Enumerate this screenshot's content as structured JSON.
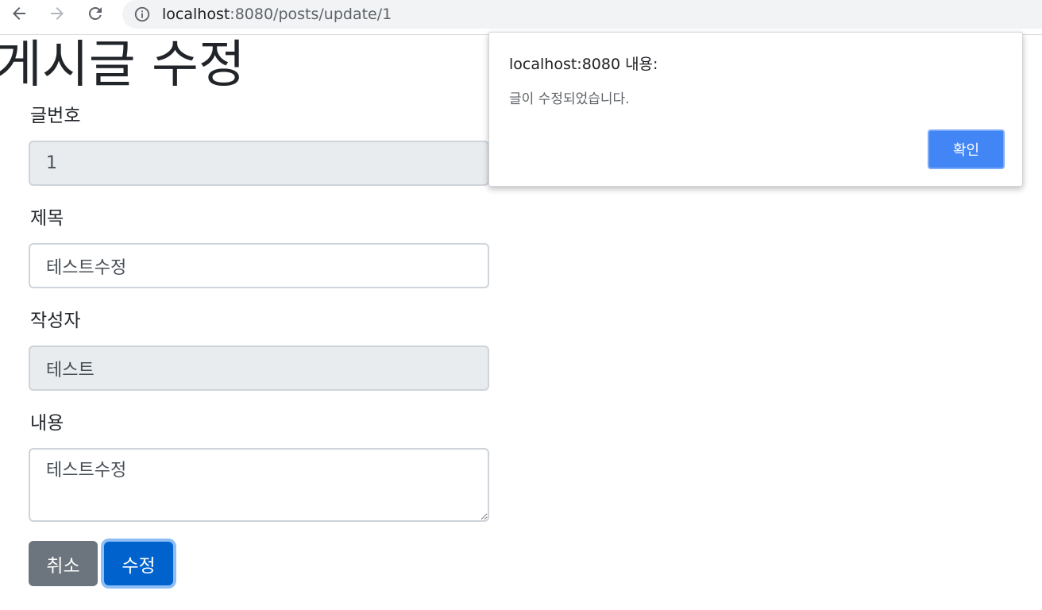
{
  "browser": {
    "url_host": "localhost",
    "url_path": ":8080/posts/update/1"
  },
  "page": {
    "title": "게시글 수정"
  },
  "form": {
    "post_number": {
      "label": "글번호",
      "value": "1"
    },
    "title_field": {
      "label": "제목",
      "value": "테스트수정"
    },
    "author": {
      "label": "작성자",
      "value": "테스트"
    },
    "content": {
      "label": "내용",
      "value": "테스트수정"
    },
    "cancel_label": "취소",
    "submit_label": "수정"
  },
  "alert": {
    "title": "localhost:8080 내용:",
    "message": "글이 수정되었습니다.",
    "ok_label": "확인"
  },
  "colors": {
    "accent": "#0062cc",
    "secondary": "#6c757d",
    "dialog_button": "#4285f4",
    "readonly_bg": "#e9ecef"
  },
  "icons": {
    "back": "arrow-left-icon",
    "forward": "arrow-right-icon",
    "reload": "reload-icon",
    "site_info": "info-icon"
  }
}
